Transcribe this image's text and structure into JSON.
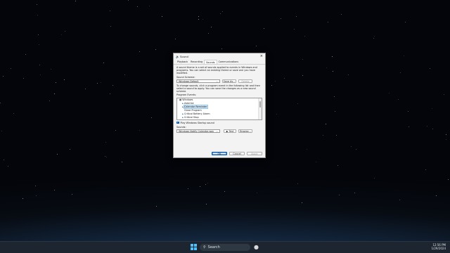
{
  "dialog": {
    "title": "Sound",
    "tabs": [
      "Playback",
      "Recording",
      "Sounds",
      "Communications"
    ],
    "active_tab": "Sounds",
    "intro": "A sound theme is a set of sounds applied to events in Windows and programs. You can select an existing theme or save one you have modified.",
    "scheme_label": "Sound Scheme:",
    "scheme_value": "Windows Default",
    "save_as_label": "Save As...",
    "delete_label": "Delete",
    "change_text": "To change sounds, click a program event in the following list and then select a sound to apply. You can save the changes as a new sound scheme.",
    "events_label": "Program Events:",
    "events": [
      {
        "label": "Windows",
        "level": 0
      },
      {
        "label": "Asterisk",
        "level": 1
      },
      {
        "label": "Calendar Reminder",
        "level": 1,
        "selected": true
      },
      {
        "label": "Close Program",
        "level": 1
      },
      {
        "label": "Critical Battery Alarm",
        "level": 1
      },
      {
        "label": "Critical Stop",
        "level": 1
      }
    ],
    "startup_label": "Play Windows Startup sound",
    "sounds_label": "Sounds:",
    "sound_value": "Windows Notify Calendar.wav",
    "test_label": "Test",
    "browse_label": "Browse...",
    "ok_label": "OK",
    "cancel_label": "Cancel",
    "apply_label": "Apply"
  },
  "taskbar": {
    "search_placeholder": "Search",
    "time": "12:56 PM",
    "date": "1/29/2024"
  },
  "icons": {
    "start": "windows-logo-icon",
    "search": "search-icon",
    "pinned": "lightbulb-icon"
  }
}
